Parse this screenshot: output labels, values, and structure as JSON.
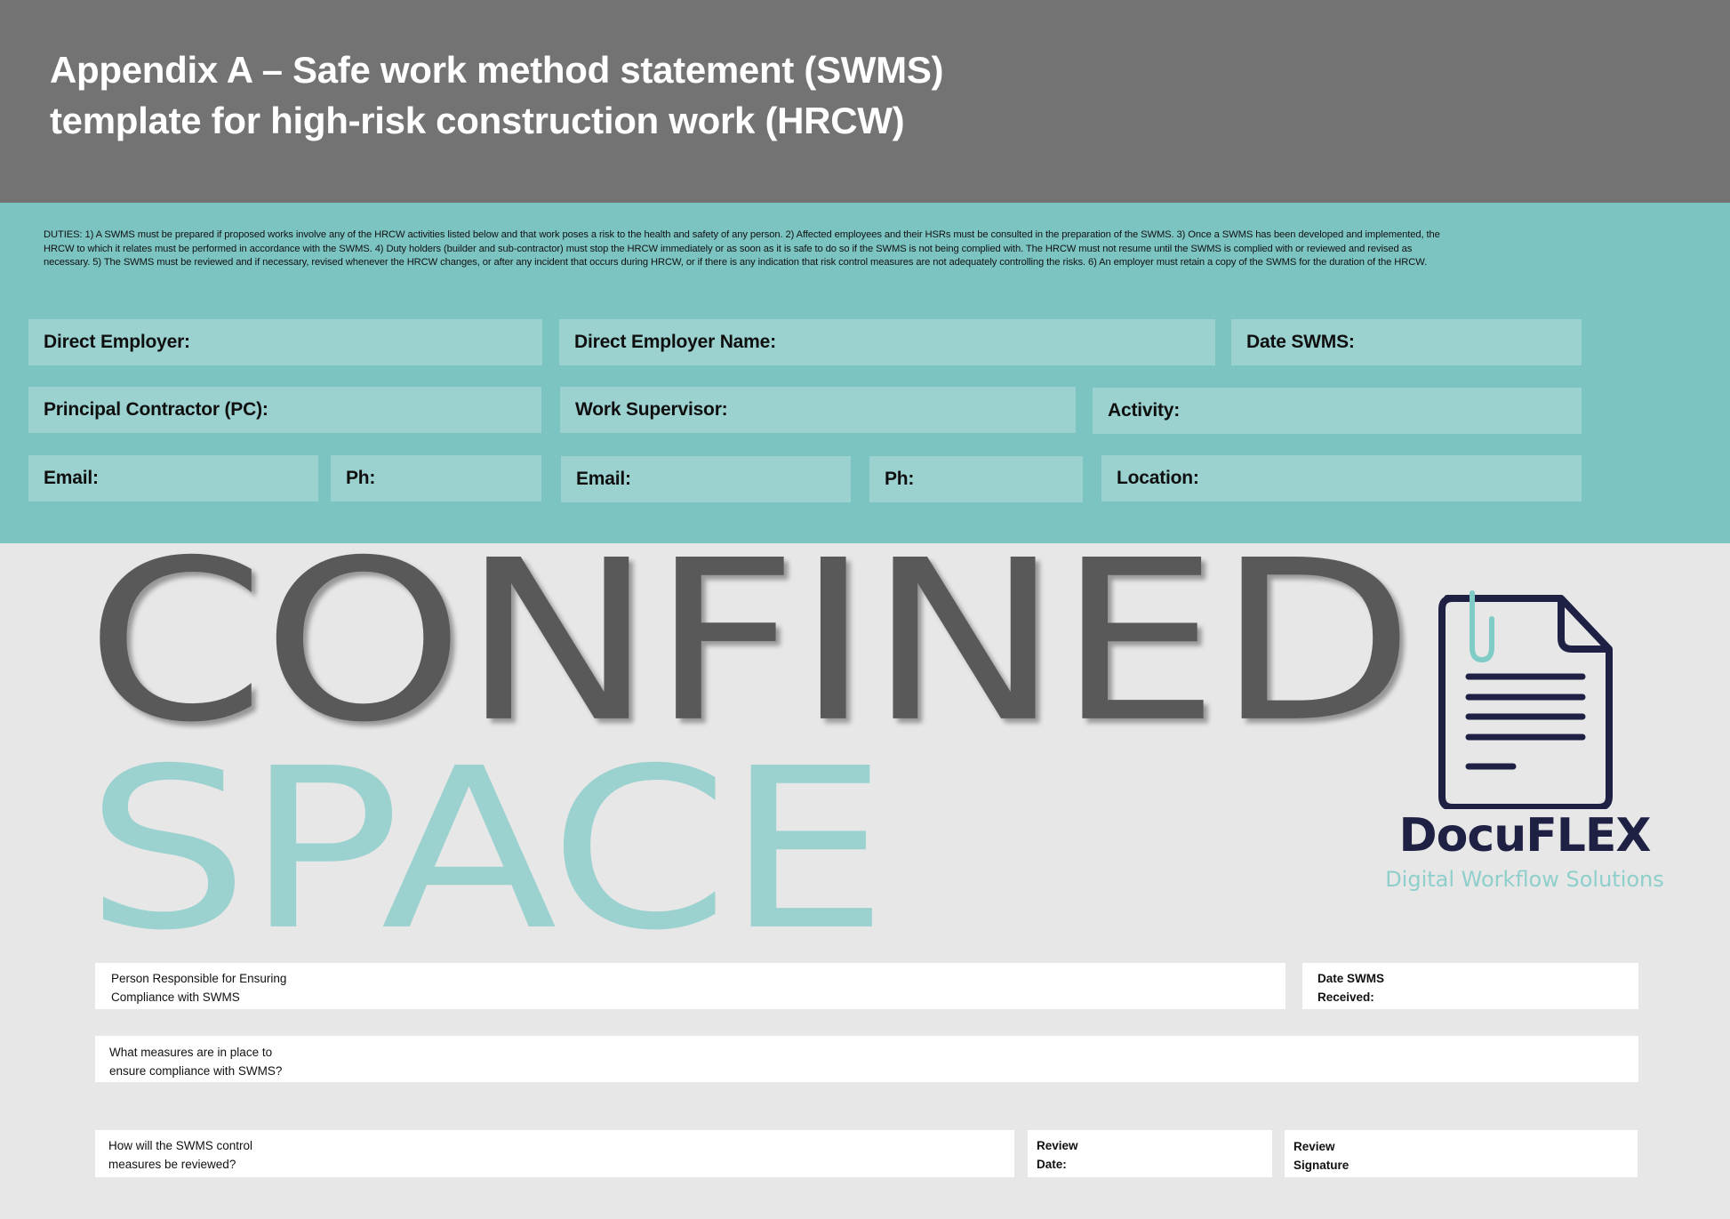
{
  "header": {
    "title_line1": "Appendix A – Safe work method statement (SWMS)",
    "title_line2": "template for high-risk construction work (HRCW)"
  },
  "duties_text": "DUTIES: 1) A SWMS must be prepared if proposed works involve any of the HRCW activities listed below and that work poses a risk to the health and safety of any person. 2) Affected employees and their HSRs must be consulted in the preparation of the SWMS. 3) Once a SWMS has been developed and implemented, the HRCW to which it relates must be performed in accordance with the SWMS. 4) Duty holders (builder and sub-contractor) must stop the HRCW immediately or as soon as it is safe to do so if the SWMS is not being complied with. The HRCW must not resume until the SWMS is complied with or reviewed and revised as necessary. 5) The SWMS must be reviewed and if necessary, revised whenever the HRCW changes, or after any incident that occurs during HRCW, or if there is any indication that risk control measures are not adequately controlling the risks. 6) An employer must retain a copy of the SWMS for the duration of the HRCW.",
  "form_fields": {
    "direct_employer": "Direct Employer:",
    "direct_employer_name": "Direct Employer Name:",
    "date_swms": "Date SWMS:",
    "principal_contractor": "Principal Contractor (PC):",
    "work_supervisor": "Work Supervisor:",
    "activity": "Activity:",
    "pc_email": "Email:",
    "pc_ph": "Ph:",
    "supervisor_email": "Email:",
    "supervisor_ph": "Ph:",
    "location": "Location:"
  },
  "hero": {
    "line1": "CONFINED",
    "line2": "SPACE"
  },
  "logo": {
    "icon": "document-with-paperclip-icon",
    "brand_name": "DocuFLEX",
    "tagline": "Digital Workflow Solutions"
  },
  "bottom_form": {
    "person_responsible_line1": "Person Responsible for Ensuring",
    "person_responsible_line2": "Compliance with SWMS",
    "date_received_line1": "Date SWMS",
    "date_received_line2": "Received:",
    "measures_line1": "What measures are in place to",
    "measures_line2": "ensure compliance with SWMS?",
    "review_how_line1": "How will the SWMS control",
    "review_how_line2": "measures be reviewed?",
    "review_date_line1": "Review",
    "review_date_line2": "Date:",
    "review_signature_line1": "Review",
    "review_signature_line2": "Signature"
  },
  "colors": {
    "header_bg": "#737373",
    "teal_band": "#7bc4c2",
    "field_bg": "#9bd2d0",
    "confined_text": "#595959",
    "space_text": "#9bd2d0",
    "brand_navy": "#1f2144",
    "brand_teal": "#8fcfcb"
  }
}
